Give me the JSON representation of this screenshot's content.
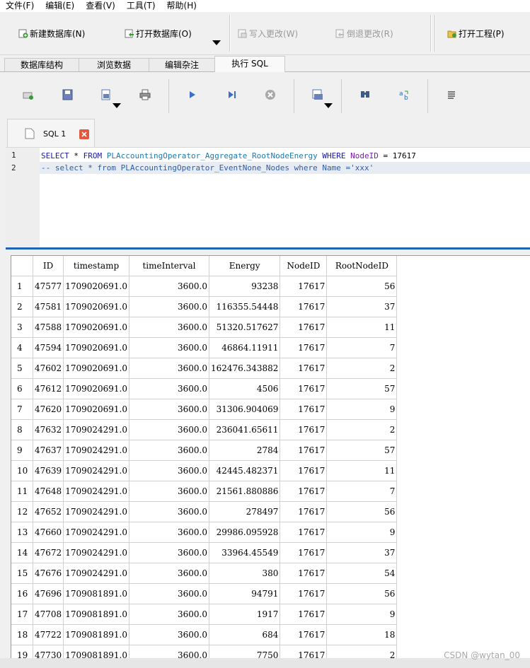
{
  "menu": [
    "文件(F)",
    "编辑(E)",
    "查看(V)",
    "工具(T)",
    "帮助(H)"
  ],
  "toolbar": {
    "new_db": "新建数据库(N)",
    "open_db": "打开数据库(O)",
    "write_changes": "写入更改(W)",
    "revert_changes": "倒退更改(R)",
    "open_project": "打开工程(P)"
  },
  "tabs": [
    "数据库结构",
    "浏览数据",
    "编辑杂注",
    "执行 SQL"
  ],
  "sql_tools": [
    "open-tab-icon",
    "open-sql-file-icon",
    "save-sql-icon",
    "print-icon",
    "execute-all-icon",
    "execute-line-icon",
    "stop-icon",
    "save-results-icon",
    "find-icon",
    "find-replace-icon",
    "comment-icon"
  ],
  "editor": {
    "tab_label": "SQL 1",
    "line_numbers": [
      "1",
      "2"
    ],
    "line1": {
      "kw1": "SELECT",
      "star_from_sp": " * ",
      "kw2": "FROM",
      "table": "PLAccountingOperator_Aggregate_RootNodeEnergy",
      "kw3": "WHERE",
      "column": "NodeID",
      "rest": " = 17617"
    },
    "line2": "-- select * from PLAccountingOperator_EventNone_Nodes where Name ='xxx'"
  },
  "results": {
    "columns": [
      "ID",
      "timestamp",
      "timeInterval",
      "Energy",
      "NodeID",
      "RootNodeID"
    ],
    "rows": [
      [
        "1",
        "47577",
        "1709020691.0",
        "3600.0",
        "93238",
        "17617",
        "56"
      ],
      [
        "2",
        "47581",
        "1709020691.0",
        "3600.0",
        "116355.54448",
        "17617",
        "37"
      ],
      [
        "3",
        "47588",
        "1709020691.0",
        "3600.0",
        "51320.517627",
        "17617",
        "11"
      ],
      [
        "4",
        "47594",
        "1709020691.0",
        "3600.0",
        "46864.11911",
        "17617",
        "7"
      ],
      [
        "5",
        "47602",
        "1709020691.0",
        "3600.0",
        "162476.343882",
        "17617",
        "2"
      ],
      [
        "6",
        "47612",
        "1709020691.0",
        "3600.0",
        "4506",
        "17617",
        "57"
      ],
      [
        "7",
        "47620",
        "1709020691.0",
        "3600.0",
        "31306.904069",
        "17617",
        "9"
      ],
      [
        "8",
        "47632",
        "1709024291.0",
        "3600.0",
        "236041.65611",
        "17617",
        "2"
      ],
      [
        "9",
        "47637",
        "1709024291.0",
        "3600.0",
        "2784",
        "17617",
        "57"
      ],
      [
        "10",
        "47639",
        "1709024291.0",
        "3600.0",
        "42445.482371",
        "17617",
        "11"
      ],
      [
        "11",
        "47648",
        "1709024291.0",
        "3600.0",
        "21561.880886",
        "17617",
        "7"
      ],
      [
        "12",
        "47652",
        "1709024291.0",
        "3600.0",
        "278497",
        "17617",
        "56"
      ],
      [
        "13",
        "47660",
        "1709024291.0",
        "3600.0",
        "29986.095928",
        "17617",
        "9"
      ],
      [
        "14",
        "47672",
        "1709024291.0",
        "3600.0",
        "33964.45549",
        "17617",
        "37"
      ],
      [
        "15",
        "47676",
        "1709024291.0",
        "3600.0",
        "380",
        "17617",
        "54"
      ],
      [
        "16",
        "47696",
        "1709081891.0",
        "3600.0",
        "94791",
        "17617",
        "56"
      ],
      [
        "17",
        "47708",
        "1709081891.0",
        "3600.0",
        "1917",
        "17617",
        "9"
      ],
      [
        "18",
        "47722",
        "1709081891.0",
        "3600.0",
        "684",
        "17617",
        "18"
      ],
      [
        "19",
        "47730",
        "1709081891.0",
        "3600.0",
        "7750",
        "17617",
        "2"
      ]
    ]
  },
  "watermark": "CSDN @wytan_00",
  "colors": {
    "accent_blue": "#1e64b4",
    "keyword": "#1a1aa6",
    "table_name": "#1d7bb0",
    "comment": "#2f5ca8"
  }
}
